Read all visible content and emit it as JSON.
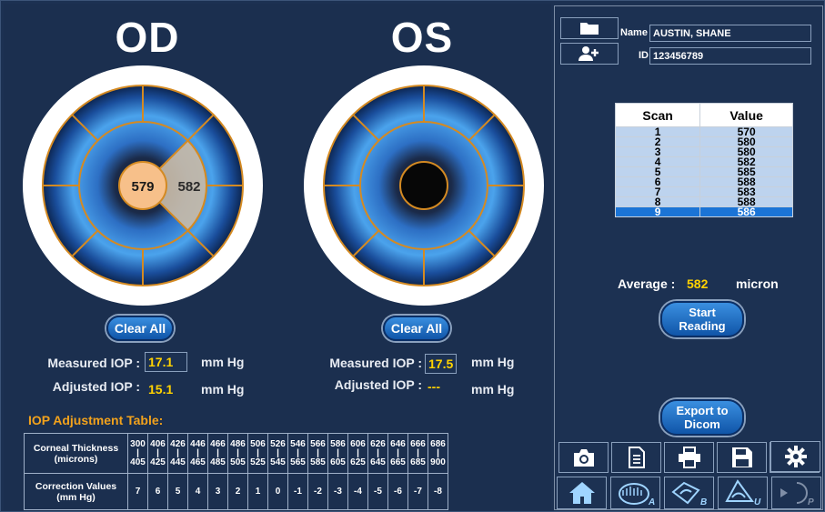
{
  "od": {
    "title": "OD",
    "center_value": "579",
    "right_value": "582",
    "clear_label": "Clear All",
    "measured_label": "Measured IOP :",
    "measured_value": "17.1",
    "adjusted_label": "Adjusted IOP :",
    "adjusted_value": "15.1",
    "unit": "mm Hg"
  },
  "os": {
    "title": "OS",
    "clear_label": "Clear All",
    "measured_label": "Measured IOP :",
    "measured_value": "17.5",
    "adjusted_label": "Adjusted IOP :",
    "adjusted_value": "---",
    "unit": "mm Hg"
  },
  "adjustment": {
    "title": "IOP Adjustment Table:",
    "thickness_label_1": "Corneal  Thickness",
    "thickness_label_2": "(microns)",
    "correction_label_1": "Correction Values",
    "correction_label_2": "(mm Hg)",
    "upper": [
      "300",
      "406",
      "426",
      "446",
      "466",
      "486",
      "506",
      "526",
      "546",
      "566",
      "586",
      "606",
      "626",
      "646",
      "666",
      "686"
    ],
    "sep": [
      "|",
      "|",
      "|",
      "|",
      "|",
      "|",
      "|",
      "|",
      "|",
      "|",
      "|",
      "|",
      "|",
      "|",
      "|",
      "|"
    ],
    "lower": [
      "405",
      "425",
      "445",
      "465",
      "485",
      "505",
      "525",
      "545",
      "565",
      "585",
      "605",
      "625",
      "645",
      "665",
      "685",
      "900"
    ],
    "corrections": [
      "7",
      "6",
      "5",
      "4",
      "3",
      "2",
      "1",
      "0",
      "-1",
      "-2",
      "-3",
      "-4",
      "-5",
      "-6",
      "-7",
      "-8"
    ]
  },
  "patient": {
    "name_label": "Name",
    "name_value": "AUSTIN, SHANE",
    "id_label": "ID",
    "id_value": "123456789"
  },
  "scan_table": {
    "header_scan": "Scan",
    "header_value": "Value",
    "rows": [
      {
        "scan": "1",
        "value": "570"
      },
      {
        "scan": "2",
        "value": "580"
      },
      {
        "scan": "3",
        "value": "580"
      },
      {
        "scan": "4",
        "value": "582"
      },
      {
        "scan": "5",
        "value": "585"
      },
      {
        "scan": "6",
        "value": "588"
      },
      {
        "scan": "7",
        "value": "583"
      },
      {
        "scan": "8",
        "value": "588"
      },
      {
        "scan": "9",
        "value": "586"
      }
    ],
    "selected_row": 9
  },
  "average": {
    "label": "Average :",
    "value": "582",
    "unit": "micron"
  },
  "buttons": {
    "start_line1": "Start",
    "start_line2": "Reading",
    "export_line1": "Export to",
    "export_line2": "Dicom"
  },
  "toolbar_icons": [
    "camera-icon",
    "document-icon",
    "print-icon",
    "save-icon",
    "pen-icon",
    "gear-icon"
  ],
  "nav": {
    "home": "home-icon",
    "mode_a_letter": "A",
    "mode_b_letter": "B",
    "mode_u_letter": "U",
    "mode_p_letter": "P"
  },
  "colors": {
    "accent_yellow": "#ffd200",
    "adjust_title": "#f2a21c",
    "selected_row": "#1b74d6",
    "panel_bg": "#1c3152"
  }
}
